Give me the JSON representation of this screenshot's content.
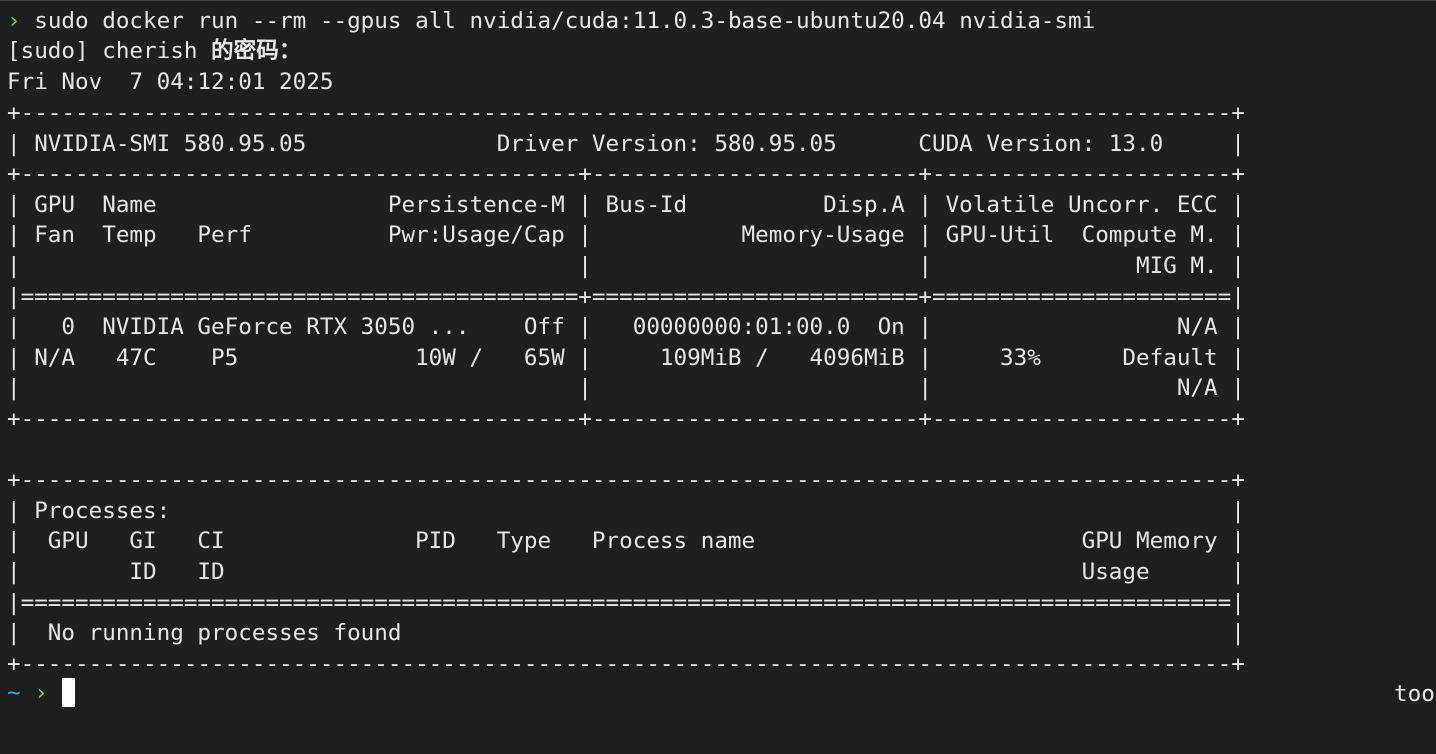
{
  "command": {
    "prompt_symbol": "›",
    "text": "sudo docker run --rm --gpus all nvidia/cuda:11.0.3-base-ubuntu20.04 nvidia-smi"
  },
  "sudo_prompt": {
    "prefix": "[sudo] cherish ",
    "cjk": "的密码："
  },
  "timestamp": "Fri Nov  7 04:12:01 2025",
  "smi_lines": [
    "+-----------------------------------------------------------------------------------------+",
    "| NVIDIA-SMI 580.95.05              Driver Version: 580.95.05      CUDA Version: 13.0     |",
    "+-----------------------------------------+------------------------+----------------------+",
    "| GPU  Name                 Persistence-M | Bus-Id          Disp.A | Volatile Uncorr. ECC |",
    "| Fan  Temp   Perf          Pwr:Usage/Cap |           Memory-Usage | GPU-Util  Compute M. |",
    "|                                         |                        |               MIG M. |",
    "|=========================================+========================+======================|",
    "|   0  NVIDIA GeForce RTX 3050 ...    Off |   00000000:01:00.0  On |                  N/A |",
    "| N/A   47C    P5             10W /   65W |     109MiB /   4096MiB |     33%      Default |",
    "|                                         |                        |                  N/A |",
    "+-----------------------------------------+------------------------+----------------------+",
    "",
    "+-----------------------------------------------------------------------------------------+",
    "| Processes:                                                                              |",
    "|  GPU   GI   CI              PID   Type   Process name                        GPU Memory |",
    "|        ID   ID                                                               Usage      |",
    "|=========================================================================================|",
    "|  No running processes found                                                             |",
    "+-----------------------------------------------------------------------------------------+"
  ],
  "shell_prompt": {
    "tilde": "~",
    "arrow": "›"
  },
  "right_prompt": "too",
  "colors": {
    "background": "#1d1f21",
    "foreground": "#e6e6e6",
    "prompt_arrow": "#7ec832",
    "prompt_tilde": "#39a7e0",
    "cursor": "#ffffff"
  }
}
